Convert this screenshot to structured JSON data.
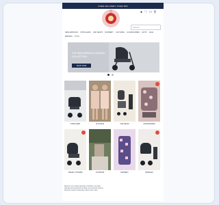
{
  "topbar": {
    "text": "FREE DELIVERY OVER $50"
  },
  "header": {
    "search_placeholder": "Search",
    "icons": [
      "user-icon",
      "heart-icon",
      "bag-icon",
      "search-icon"
    ]
  },
  "nav": {
    "items": [
      "NEW ARRIVALS",
      "STROLLERS",
      "CAR SEATS",
      "NURSERY",
      "CLOTHING",
      "ACCESSORIES",
      "GIFTS",
      "SALE",
      "BRANDS",
      "TOYS"
    ]
  },
  "hero": {
    "title": "THE NEW ARRIVALS SEASON COLLECTION",
    "button": "SHOP NOW"
  },
  "products": [
    {
      "label": "STROLLERS"
    },
    {
      "label": "CLOTHING"
    },
    {
      "label": "CAR SEATS"
    },
    {
      "label": "ACCESSORIES"
    },
    {
      "label": "TRAVEL SYSTEMS"
    },
    {
      "label": "OUTDOOR"
    },
    {
      "label": "NURSERY"
    },
    {
      "label": "BUNDLES"
    }
  ],
  "footer": {
    "line1": "Discover our curated selection of strollers, car seats,",
    "line2": "clothing and accessories for little ones and their parents.",
    "line3": "Shop the season's favourites online and in store."
  }
}
